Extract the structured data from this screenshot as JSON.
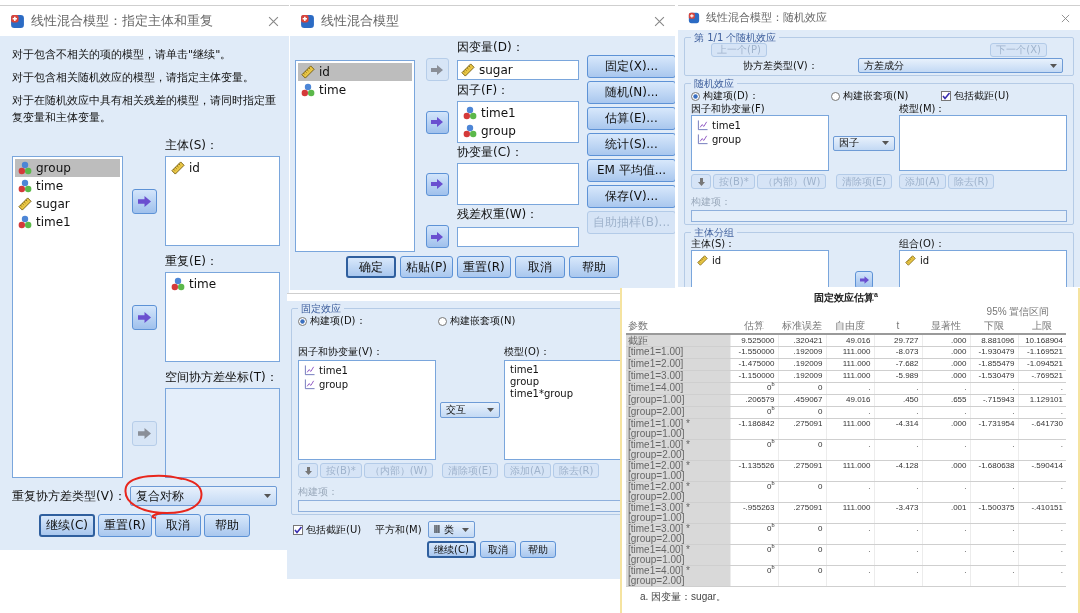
{
  "subject_dialog": {
    "title": "线性混合模型：指定主体和重复",
    "instructions": [
      "对于包含不相关的项的模型，请单击\"继续\"。",
      "对于包含相关随机效应的模型，请指定主体变量。",
      "对于在随机效应中具有相关残差的模型，请同时指定重复变量和主体变量。"
    ],
    "variables": [
      {
        "name": "group",
        "kind": "nominal",
        "selected": true
      },
      {
        "name": "time",
        "kind": "nominal",
        "selected": false
      },
      {
        "name": "sugar",
        "kind": "scale",
        "selected": false
      },
      {
        "name": "time1",
        "kind": "nominal",
        "selected": false
      }
    ],
    "targets": [
      {
        "label": "主体(S)：",
        "items": [
          {
            "name": "id",
            "kind": "scale"
          }
        ],
        "disabled": false
      },
      {
        "label": "重复(E)：",
        "items": [
          {
            "name": "time",
            "kind": "nominal"
          }
        ],
        "disabled": false
      },
      {
        "label": "空间协方差坐标(T)：",
        "disabled": true
      }
    ],
    "covariance": {
      "label": "重复协方差类型(V)：",
      "value": "复合对称",
      "annotated": true
    },
    "buttons": [
      {
        "label": "继续(C)",
        "default": true
      },
      {
        "label": "重置(R)",
        "default": false
      },
      {
        "label": "取消",
        "default": false
      },
      {
        "label": "帮助",
        "default": false
      }
    ]
  },
  "main_dialog": {
    "title": "线性混合模型",
    "variables": [
      {
        "name": "id",
        "kind": "scale",
        "selected": true
      },
      {
        "name": "time",
        "kind": "nominal",
        "selected": false
      }
    ],
    "targets": [
      {
        "label": "因变量(D)：",
        "kind": "field",
        "items": [
          {
            "name": "sugar",
            "kind": "scale"
          }
        ],
        "disabled": true
      },
      {
        "label": "因子(F)：",
        "kind": "list",
        "items": [
          {
            "name": "time1",
            "kind": "nominal"
          },
          {
            "name": "group",
            "kind": "nominal"
          }
        ],
        "disabled": false
      },
      {
        "label": "协变量(C)：",
        "kind": "list",
        "disabled": false
      },
      {
        "label": "残差权重(W)：",
        "kind": "field",
        "disabled": false
      }
    ],
    "side_buttons": [
      {
        "label": "固定(X)...",
        "disabled": false
      },
      {
        "label": "随机(N)...",
        "disabled": false
      },
      {
        "label": "估算(E)...",
        "disabled": false
      },
      {
        "label": "统计(S)...",
        "disabled": false
      },
      {
        "label": "EM 平均值...",
        "disabled": false
      },
      {
        "label": "保存(V)...",
        "disabled": false
      },
      {
        "label": "自助抽样(B)...",
        "disabled": true
      }
    ],
    "buttons": [
      {
        "label": "确定",
        "default": true
      },
      {
        "label": "粘贴(P)",
        "default": false
      },
      {
        "label": "重置(R)",
        "default": false
      },
      {
        "label": "取消",
        "default": false
      },
      {
        "label": "帮助",
        "default": false
      }
    ]
  },
  "random_dialog": {
    "title": "线性混合模型：随机效应",
    "group_title": "第 1/1 个随机效应",
    "nav_buttons": [
      {
        "label": "上一个(P)",
        "disabled": true
      },
      {
        "label": "下一个(X)",
        "disabled": true
      }
    ],
    "covariance": {
      "label": "协方差类型(V)：",
      "value": "方差成分"
    },
    "section_title": "随机效应",
    "radios": [
      {
        "label": "构建项(D)：",
        "selected": true
      },
      {
        "label": "构建嵌套项(N)",
        "selected": false
      }
    ],
    "intercept": {
      "label": "包括截距(U)",
      "checked": true
    },
    "factors_label": "因子和协变量(F)",
    "factors": [
      "time1",
      "group"
    ],
    "term_type": "因子",
    "model_label": "模型(M)：",
    "term_buttons": {
      "left": [
        {
          "kind": "down",
          "disabled": true
        },
        {
          "kind": "text",
          "label": "按(B)*",
          "disabled": true
        },
        {
          "kind": "text",
          "label": "（内部）(W)",
          "disabled": true
        }
      ],
      "middle": [
        {
          "kind": "text",
          "label": "清除项(E)",
          "disabled": true
        }
      ],
      "right": [
        {
          "kind": "text",
          "label": "添加(A)",
          "disabled": true
        },
        {
          "kind": "text",
          "label": "除去(R)",
          "disabled": true
        }
      ]
    },
    "build": {
      "label": "构建项：",
      "disabled": true
    },
    "subject_section": "主体分组",
    "subjects_label": "主体(S)：",
    "subjects": [
      {
        "name": "id",
        "kind": "scale"
      }
    ],
    "combos_arrow": {
      "disabled": false
    },
    "combos_label": "组合(O)：",
    "combos": [
      {
        "name": "id",
        "kind": "scale"
      }
    ]
  },
  "fixed_dialog": {
    "group_title": "固定效应",
    "radios": [
      {
        "label": "构建项(D)：",
        "selected": true
      },
      {
        "label": "构建嵌套项(N)",
        "selected": false
      }
    ],
    "factors_label": "因子和协变量(V)：",
    "factors": [
      "time1",
      "group"
    ],
    "term_type": "交互",
    "model_label": "模型(O)：",
    "model": [
      "time1",
      "group",
      "time1*group"
    ],
    "term_buttons": {
      "left": [
        {
          "kind": "down",
          "disabled": true
        },
        {
          "kind": "text",
          "label": "按(B)*",
          "disabled": true
        },
        {
          "kind": "text",
          "label": "（内部）(W)",
          "disabled": true
        }
      ],
      "middle": [
        {
          "kind": "text",
          "label": "清除项(E)",
          "disabled": true
        }
      ],
      "right": [
        {
          "kind": "text",
          "label": "添加(A)",
          "disabled": true
        },
        {
          "kind": "text",
          "label": "除去(R)",
          "disabled": true
        }
      ]
    },
    "build": {
      "label": "构建项：",
      "disabled": true
    },
    "intercept": {
      "label": "包括截距(U)",
      "checked": true
    },
    "ss": {
      "label": "平方和(M)",
      "value": "Ⅲ 类"
    },
    "buttons": [
      {
        "label": "继续(C)",
        "default": true
      },
      {
        "label": "取消",
        "default": false
      },
      {
        "label": "帮助",
        "default": false
      }
    ]
  },
  "estimates_table": {
    "title": "固定效应估算$^{a}$",
    "group_header": "95% 置信区间",
    "columns": [
      "参数",
      "估算",
      "标准误差",
      "自由度",
      "t",
      "显著性",
      "下限",
      "上限"
    ],
    "rows": [
      [
        "截距",
        "9.525000",
        ".320421",
        "49.016",
        "29.727",
        ".000",
        "8.881096",
        "10.168904"
      ],
      [
        "[time1=1.00]",
        "-1.550000",
        ".192009",
        "111.000",
        "-8.073",
        ".000",
        "-1.930479",
        "-1.169521"
      ],
      [
        "[time1=2.00]",
        "-1.475000",
        ".192009",
        "111.000",
        "-7.682",
        ".000",
        "-1.855479",
        "-1.094521"
      ],
      [
        "[time1=3.00]",
        "-1.150000",
        ".192009",
        "111.000",
        "-5.989",
        ".000",
        "-1.530479",
        "-.769521"
      ],
      [
        "[time1=4.00]",
        "0$^{b}$",
        "0",
        ".",
        ".",
        ".",
        ".",
        "."
      ],
      [
        "[group=1.00]",
        ".206579",
        ".459067",
        "49.016",
        ".450",
        ".655",
        "-.715943",
        "1.129101"
      ],
      [
        "[group=2.00]",
        "0$^{b}$",
        "0",
        ".",
        ".",
        ".",
        ".",
        "."
      ],
      [
        "[time1=1.00] * [group=1.00]",
        "-1.186842",
        ".275091",
        "111.000",
        "-4.314",
        ".000",
        "-1.731954",
        "-.641730"
      ],
      [
        "[time1=1.00] * [group=2.00]",
        "0$^{b}$",
        "0",
        ".",
        ".",
        ".",
        ".",
        "."
      ],
      [
        "[time1=2.00] * [group=1.00]",
        "-1.135526",
        ".275091",
        "111.000",
        "-4.128",
        ".000",
        "-1.680638",
        "-.590414"
      ],
      [
        "[time1=2.00] * [group=2.00]",
        "0$^{b}$",
        "0",
        ".",
        ".",
        ".",
        ".",
        "."
      ],
      [
        "[time1=3.00] * [group=1.00]",
        "-.955263",
        ".275091",
        "111.000",
        "-3.473",
        ".001",
        "-1.500375",
        "-.410151"
      ],
      [
        "[time1=3.00] * [group=2.00]",
        "0$^{b}$",
        "0",
        ".",
        ".",
        ".",
        ".",
        "."
      ],
      [
        "[time1=4.00] * [group=1.00]",
        "0$^{b}$",
        "0",
        ".",
        ".",
        ".",
        ".",
        "."
      ],
      [
        "[time1=4.00] * [group=2.00]",
        "0$^{b}$",
        "0",
        ".",
        ".",
        ".",
        ".",
        "."
      ]
    ],
    "footnote": "a. 因变量：sugar。"
  }
}
